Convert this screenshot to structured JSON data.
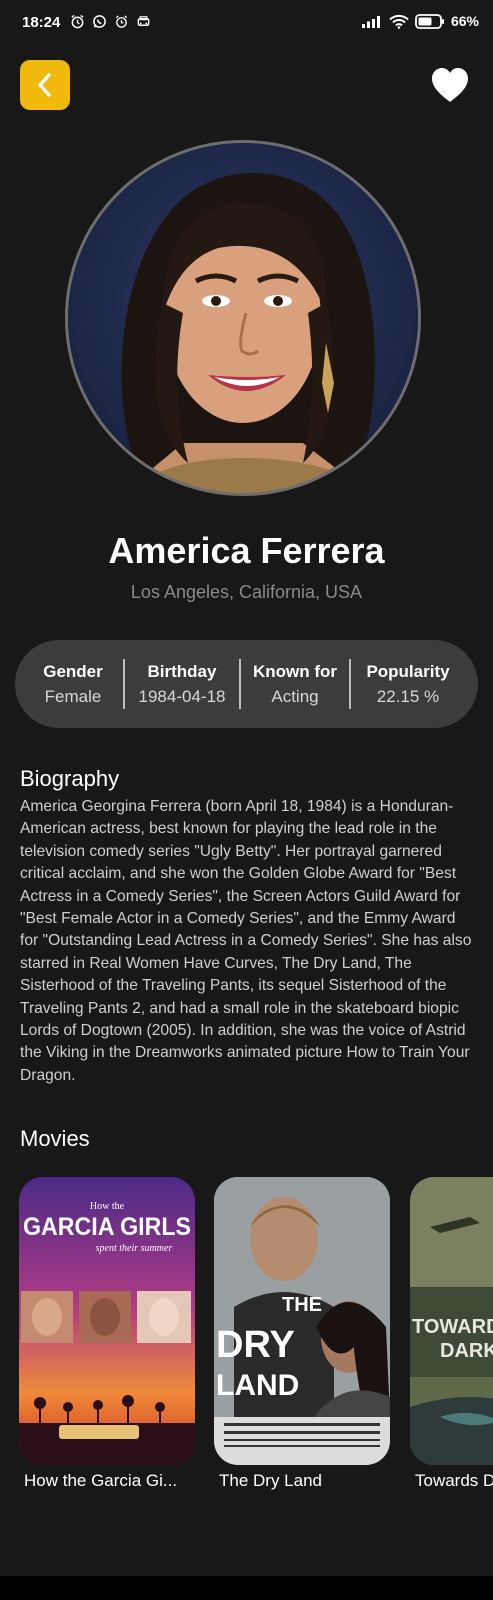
{
  "status_bar": {
    "time": "18:24",
    "battery": "66%",
    "left_icons": [
      "alarm-icon",
      "whatsapp-icon",
      "alarm-clock-icon",
      "car-icon"
    ],
    "right_icons": [
      "signal-icon",
      "wifi-icon",
      "battery-icon"
    ]
  },
  "header": {
    "back_icon": "chevron-left-icon",
    "favorite_icon": "heart-icon",
    "accent_color": "#f0b90b"
  },
  "person": {
    "name": "America Ferrera",
    "birthplace": "Los Angeles, California, USA"
  },
  "stats": [
    {
      "label": "Gender",
      "value": "Female"
    },
    {
      "label": "Birthday",
      "value": "1984-04-18"
    },
    {
      "label": "Known for",
      "value": "Acting"
    },
    {
      "label": "Popularity",
      "value": "22.15 %"
    }
  ],
  "biography": {
    "title": "Biography",
    "text": "America Georgina Ferrera (born April 18, 1984) is a Honduran-American actress, best known for playing the lead role in the television comedy series \"Ugly Betty\". Her portrayal garnered critical acclaim, and she won the Golden Globe Award for \"Best Actress in a Comedy Series\", the Screen Actors Guild Award for \"Best Female Actor in a Comedy Series\", and the Emmy Award for \"Outstanding Lead Actress in a Comedy Series\". She has also starred in Real Women Have Curves, The Dry Land, The Sisterhood of the Traveling Pants, its sequel Sisterhood of the Traveling Pants 2, and had a small role in the skateboard biopic Lords of Dogtown (2005). In addition, she was the voice of Astrid the Viking in the Dreamworks animated picture How to Train Your Dragon."
  },
  "movies": {
    "title": "Movies",
    "items": [
      {
        "title": "How the Garcia Gi...",
        "poster_text": {
          "top": "How the",
          "main": "GARCIA GIRLS",
          "sub": "spent their summer"
        }
      },
      {
        "title": "The Dry Land",
        "poster_text": {
          "main_1": "THE",
          "main_2": "DRY",
          "main_3": "LAND"
        }
      },
      {
        "title": "Towards D",
        "poster_text": {
          "main_1": "TOWARDS",
          "main_2": "DARK"
        }
      }
    ]
  }
}
